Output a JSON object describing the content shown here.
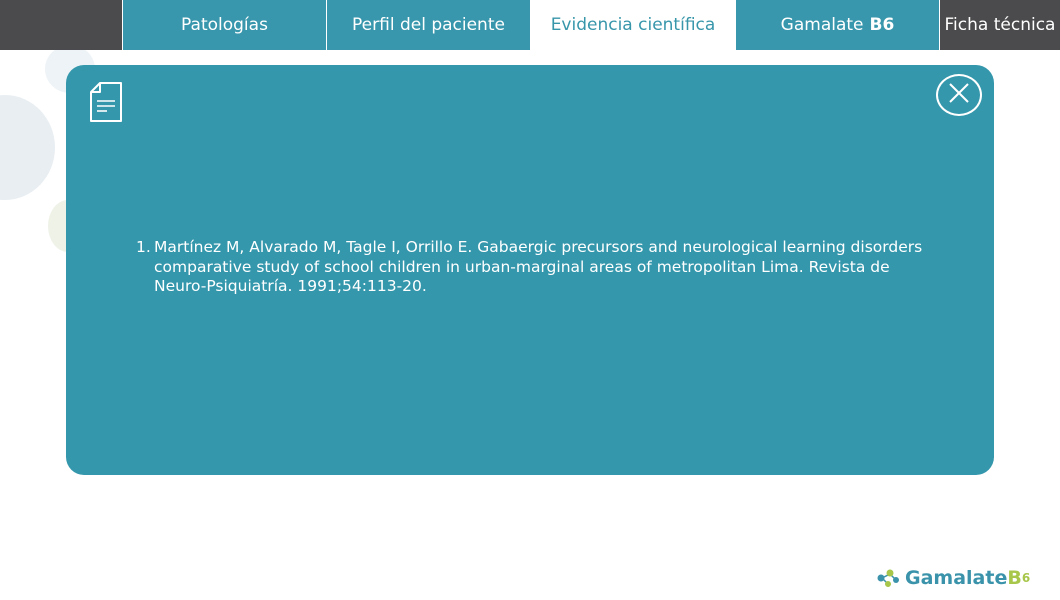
{
  "nav": {
    "tabs": [
      {
        "label": "Patologías"
      },
      {
        "label": "Perfil del paciente"
      },
      {
        "label": "Evidencia científica",
        "active": true
      },
      {
        "label_main": "Gamalate",
        "label_bold": "B6"
      },
      {
        "label": "Ficha técnica"
      }
    ]
  },
  "modal": {
    "icon": "document-icon",
    "close_icon": "close-icon",
    "reference": {
      "number": "1.",
      "text": "Martínez M, Alvarado M, Tagle I, Orrillo E. Gabaergic precursors and neurological learning disorders comparative study of school children in urban-marginal areas of metropolitan Lima. Revista de Neuro-Psiquiatría. 1991;54:113-20."
    }
  },
  "brand": {
    "name": "Gamalate",
    "b": "B",
    "six": "6",
    "icon": "molecule-logo-icon"
  },
  "colors": {
    "accent": "#3497ac",
    "dark": "#4b4b4d",
    "brand_green": "#a7c64a"
  }
}
